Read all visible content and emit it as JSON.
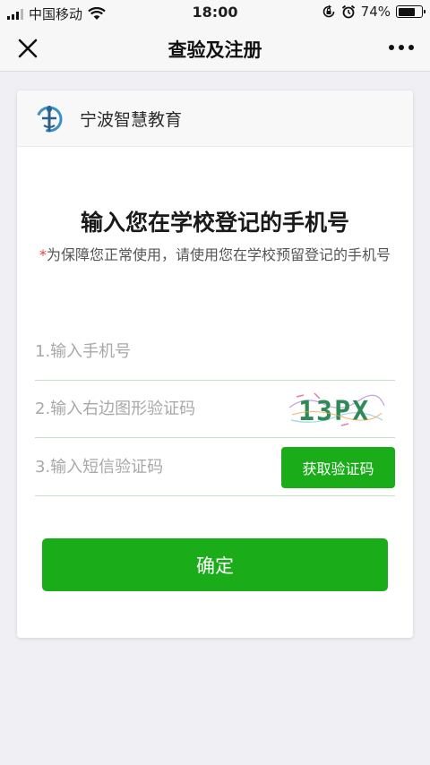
{
  "status_bar": {
    "carrier": "中国移动",
    "time": "18:00",
    "battery_percent": "74%",
    "battery_level": 0.74,
    "icons": [
      "signal-icon",
      "wifi-icon",
      "orientation-lock-icon",
      "alarm-icon",
      "battery-icon"
    ]
  },
  "nav": {
    "title": "查验及注册",
    "left_icon": "close-icon",
    "right_icon": "more-icon"
  },
  "card": {
    "school_name": "宁波智慧教育",
    "title": "输入您在学校登记的手机号",
    "required_mark": "*",
    "subtitle": "为保障您正常使用，请使用您在学校预留登记的手机号"
  },
  "form": {
    "phone_placeholder": "1.输入手机号",
    "captcha_placeholder": "2.输入右边图形验证码",
    "captcha_text": "13PX",
    "sms_placeholder": "3.输入短信验证码",
    "sms_button": "获取验证码",
    "confirm_button": "确定"
  },
  "colors": {
    "primary": "#1aad19",
    "required": "#e64340",
    "background": "#efeff4"
  }
}
